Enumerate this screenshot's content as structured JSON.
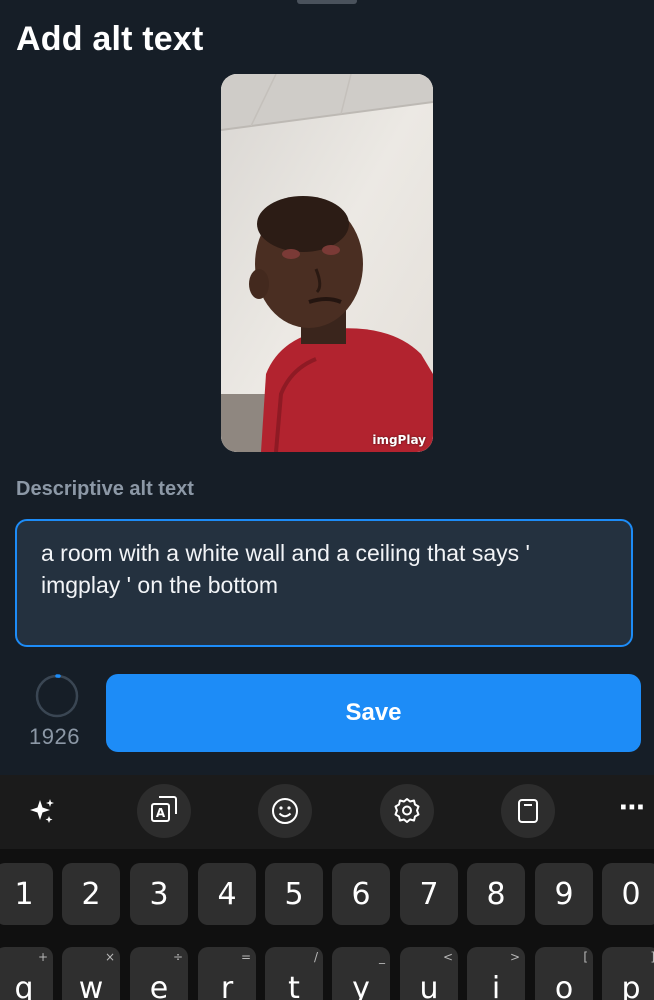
{
  "header": {
    "title": "Add alt text"
  },
  "image": {
    "watermark": "imgPlay"
  },
  "alt_text": {
    "label": "Descriptive alt text",
    "value": "a room with a white wall and a ceiling that says ' imgplay ' on the bottom"
  },
  "counter": {
    "remaining": "1926"
  },
  "actions": {
    "save_label": "Save"
  },
  "keyboard": {
    "toolbar": {
      "icons": [
        "sparkle-icon",
        "translate-icon",
        "emoji-icon",
        "settings-icon",
        "clipboard-icon",
        "more-icon"
      ],
      "more_label": "⋯"
    },
    "number_row": [
      "1",
      "2",
      "3",
      "4",
      "5",
      "6",
      "7",
      "8",
      "9",
      "0"
    ],
    "letter_row": [
      {
        "key": "q",
        "sub": "+"
      },
      {
        "key": "w",
        "sub": "×"
      },
      {
        "key": "e",
        "sub": "÷"
      },
      {
        "key": "r",
        "sub": "="
      },
      {
        "key": "t",
        "sub": "/"
      },
      {
        "key": "y",
        "sub": "_"
      },
      {
        "key": "u",
        "sub": "<"
      },
      {
        "key": "i",
        "sub": ">"
      },
      {
        "key": "o",
        "sub": "["
      },
      {
        "key": "p",
        "sub": "]"
      }
    ]
  },
  "colors": {
    "background": "#161e27",
    "accent": "#1d8cf7",
    "field_background": "#24313f",
    "muted_text": "#8c98a6"
  }
}
